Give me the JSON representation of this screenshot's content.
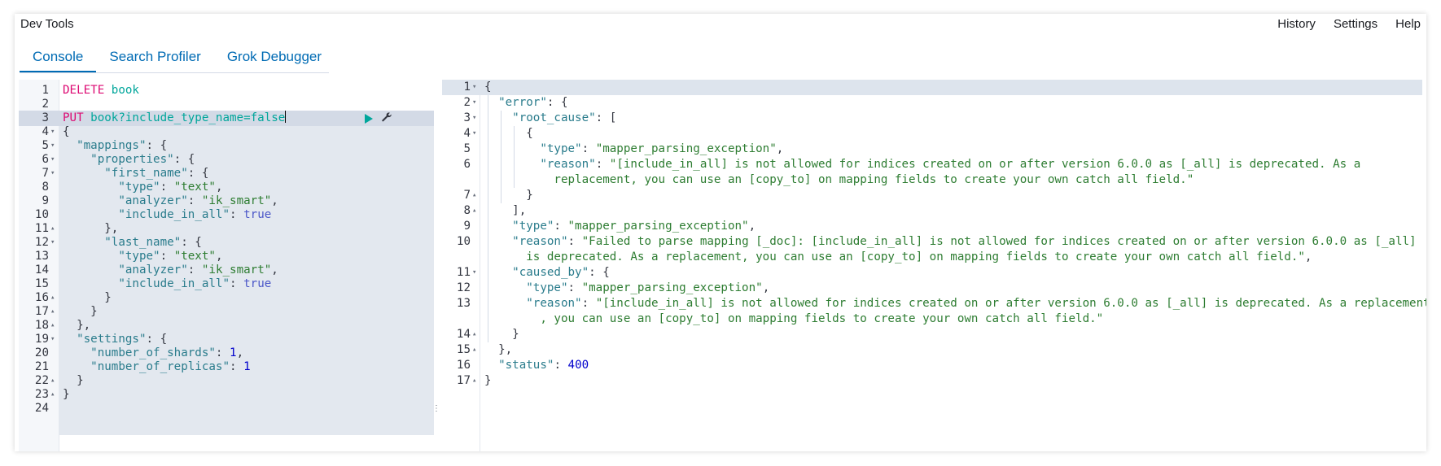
{
  "header": {
    "title": "Dev Tools",
    "links": [
      "History",
      "Settings",
      "Help"
    ]
  },
  "tabs": [
    {
      "label": "Console",
      "active": true
    },
    {
      "label": "Search Profiler",
      "active": false
    },
    {
      "label": "Grok Debugger",
      "active": false
    }
  ],
  "editor": {
    "request_1_method": "DELETE",
    "request_1_url": "book",
    "request_2_method": "PUT",
    "request_2_url": "book?include_type_name=false",
    "lines": [
      {
        "n": "1",
        "fold": ""
      },
      {
        "n": "2",
        "fold": ""
      },
      {
        "n": "3",
        "fold": ""
      },
      {
        "n": "4",
        "fold": "▾",
        "code": "{"
      },
      {
        "n": "5",
        "fold": "▾"
      },
      {
        "n": "6",
        "fold": "▾"
      },
      {
        "n": "7",
        "fold": "▾"
      },
      {
        "n": "8",
        "fold": ""
      },
      {
        "n": "9",
        "fold": ""
      },
      {
        "n": "10",
        "fold": ""
      },
      {
        "n": "11",
        "fold": "▴",
        "code": "      },"
      },
      {
        "n": "12",
        "fold": "▾"
      },
      {
        "n": "13",
        "fold": ""
      },
      {
        "n": "14",
        "fold": ""
      },
      {
        "n": "15",
        "fold": ""
      },
      {
        "n": "16",
        "fold": "▴",
        "code": "      }"
      },
      {
        "n": "17",
        "fold": "▴",
        "code": "    }"
      },
      {
        "n": "18",
        "fold": "▴",
        "code": "  },"
      },
      {
        "n": "19",
        "fold": "▾"
      },
      {
        "n": "20",
        "fold": ""
      },
      {
        "n": "21",
        "fold": ""
      },
      {
        "n": "22",
        "fold": "▴",
        "code": "  }"
      },
      {
        "n": "23",
        "fold": "▴",
        "code": "}"
      },
      {
        "n": "24",
        "fold": ""
      }
    ],
    "body": {
      "mappings_key": "\"mappings\"",
      "properties_key": "\"properties\"",
      "first_name_key": "\"first_name\"",
      "last_name_key": "\"last_name\"",
      "type_key": "\"type\"",
      "type_val": "\"text\"",
      "analyzer_key": "\"analyzer\"",
      "analyzer_val": "\"ik_smart\"",
      "include_key": "\"include_in_all\"",
      "include_val": "true",
      "settings_key": "\"settings\"",
      "shards_key": "\"number_of_shards\"",
      "shards_val": "1",
      "replicas_key": "\"number_of_replicas\"",
      "replicas_val": "1"
    }
  },
  "output": {
    "lines": [
      {
        "n": "1",
        "fold": "▾"
      },
      {
        "n": "2",
        "fold": "▾"
      },
      {
        "n": "3",
        "fold": "▾"
      },
      {
        "n": "4",
        "fold": "▾"
      },
      {
        "n": "5",
        "fold": ""
      },
      {
        "n": "6",
        "fold": ""
      },
      {
        "n": "",
        "fold": ""
      },
      {
        "n": "7",
        "fold": "▴"
      },
      {
        "n": "8",
        "fold": "▴"
      },
      {
        "n": "9",
        "fold": ""
      },
      {
        "n": "10",
        "fold": ""
      },
      {
        "n": "",
        "fold": ""
      },
      {
        "n": "11",
        "fold": "▾"
      },
      {
        "n": "12",
        "fold": ""
      },
      {
        "n": "13",
        "fold": ""
      },
      {
        "n": "",
        "fold": ""
      },
      {
        "n": "14",
        "fold": "▴"
      },
      {
        "n": "15",
        "fold": "▴"
      },
      {
        "n": "16",
        "fold": ""
      },
      {
        "n": "17",
        "fold": "▴"
      }
    ],
    "error_key": "\"error\"",
    "root_cause_key": "\"root_cause\"",
    "type_key": "\"type\"",
    "reason_key": "\"reason\"",
    "caused_by_key": "\"caused_by\"",
    "status_key": "\"status\"",
    "exception": "\"mapper_parsing_exception\"",
    "reason_1a": "\"[include_in_all] is not allowed for indices created on or after version 6.0.0 as [_all] is deprecated. As a",
    "reason_1b": "replacement, you can use an [copy_to] on mapping fields to create your own catch all field.\"",
    "reason_2a": "\"Failed to parse mapping [_doc]: [include_in_all] is not allowed for indices created on or after version 6.0.0 as [_all]",
    "reason_2b": "is deprecated. As a replacement, you can use an [copy_to] on mapping fields to create your own catch all field.\"",
    "reason_3a": "\"[include_in_all] is not allowed for indices created on or after version 6.0.0 as [_all] is deprecated. As a replacement",
    "reason_3b": ", you can use an [copy_to] on mapping fields to create your own catch all field.\"",
    "status_val": "400"
  },
  "icons": {
    "run": "play-icon",
    "settings": "wrench-icon"
  },
  "colors": {
    "accent": "#006bb4",
    "method": "#dd0a73",
    "url": "#00a69b",
    "string": "#2e7d32",
    "number": "#0000cd"
  }
}
